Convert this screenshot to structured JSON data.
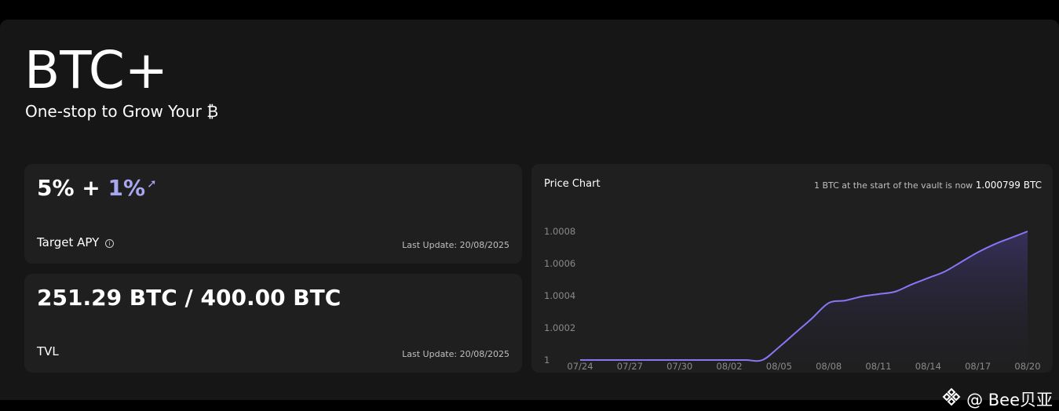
{
  "header": {
    "title": "BTC+",
    "subtitle": "One-stop to Grow Your ₿"
  },
  "apy_card": {
    "base": "5%",
    "plus": "+",
    "bonus": "1%",
    "bonus_icon": "rocket-icon",
    "label": "Target APY",
    "info_icon": "info-icon",
    "last_update": "Last Update: 20/08/2025"
  },
  "tvl_card": {
    "value": "251.29 BTC / 400.00 BTC",
    "label": "TVL",
    "last_update": "Last Update: 20/08/2025"
  },
  "price_chart": {
    "title": "Price Chart",
    "note_prefix": "1 BTC at the start of the vault is now",
    "note_value": "1.000799 BTC"
  },
  "chart_data": {
    "type": "area",
    "title": "Price Chart",
    "xlabel": "",
    "ylabel": "",
    "x_ticks": [
      "07/24",
      "07/27",
      "07/30",
      "08/02",
      "08/05",
      "08/08",
      "08/11",
      "08/14",
      "08/17",
      "08/20"
    ],
    "y_ticks": [
      "1",
      "1.0002",
      "1.0004",
      "1.0006",
      "1.0008"
    ],
    "ylim": [
      1,
      1.0008
    ],
    "series": [
      {
        "color": "#8577f5",
        "x": [
          "07/24",
          "07/25",
          "07/26",
          "07/27",
          "07/28",
          "07/29",
          "07/30",
          "07/31",
          "08/01",
          "08/02",
          "08/03",
          "08/04",
          "08/05",
          "08/06",
          "08/07",
          "08/08",
          "08/09",
          "08/10",
          "08/11",
          "08/12",
          "08/13",
          "08/14",
          "08/15",
          "08/16",
          "08/17",
          "08/18",
          "08/19",
          "08/20"
        ],
        "values": [
          1.0,
          1.0,
          1.0,
          1.0,
          1.0,
          1.0,
          1.0,
          1.0,
          1.0,
          1.0,
          1.0,
          1.0,
          1.00008,
          1.00017,
          1.00026,
          1.000355,
          1.00037,
          1.000395,
          1.00041,
          1.000425,
          1.00047,
          1.00051,
          1.00055,
          1.00061,
          1.00067,
          1.00072,
          1.00076,
          1.0008
        ]
      }
    ],
    "grid": false,
    "legend": "none"
  },
  "watermark": {
    "icon": "binance-icon",
    "text": "@ Bee贝亚"
  }
}
